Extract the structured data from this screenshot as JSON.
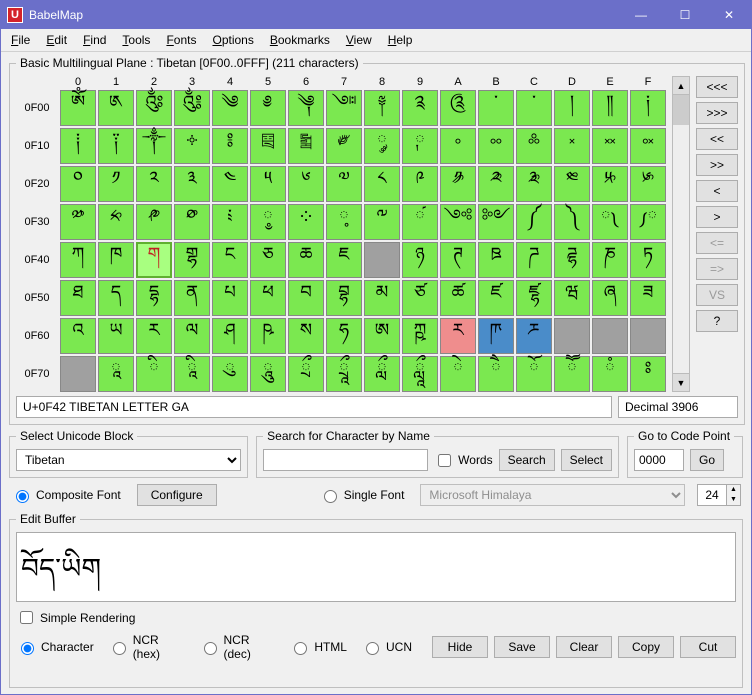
{
  "window": {
    "title": "BabelMap",
    "icon_letter": "U"
  },
  "menubar": [
    "File",
    "Edit",
    "Find",
    "Tools",
    "Fonts",
    "Options",
    "Bookmarks",
    "View",
    "Help"
  ],
  "grid": {
    "legend": "Basic Multilingual Plane : Tibetan [0F00..0FFF] (211 characters)",
    "col_headers": [
      "0",
      "1",
      "2",
      "3",
      "4",
      "5",
      "6",
      "7",
      "8",
      "9",
      "A",
      "B",
      "C",
      "D",
      "E",
      "F"
    ],
    "rows": [
      {
        "hdr": "0F00",
        "cells": [
          {
            "g": "ༀ",
            "c": "g"
          },
          {
            "g": "༁",
            "c": "g"
          },
          {
            "g": "༂",
            "c": "g"
          },
          {
            "g": "༃",
            "c": "g"
          },
          {
            "g": "༄",
            "c": "g"
          },
          {
            "g": "༅",
            "c": "g"
          },
          {
            "g": "༆",
            "c": "g"
          },
          {
            "g": "༇",
            "c": "g"
          },
          {
            "g": "༈",
            "c": "g"
          },
          {
            "g": "༉",
            "c": "g"
          },
          {
            "g": "༊",
            "c": "g"
          },
          {
            "g": "་",
            "c": "g"
          },
          {
            "g": "༌",
            "c": "g"
          },
          {
            "g": "།",
            "c": "g"
          },
          {
            "g": "༎",
            "c": "g"
          },
          {
            "g": "༏",
            "c": "g"
          }
        ]
      },
      {
        "hdr": "0F10",
        "cells": [
          {
            "g": "༐",
            "c": "g"
          },
          {
            "g": "༑",
            "c": "g"
          },
          {
            "g": "༒",
            "c": "g"
          },
          {
            "g": "༓",
            "c": "g"
          },
          {
            "g": "༔",
            "c": "g"
          },
          {
            "g": "༕",
            "c": "g"
          },
          {
            "g": "༖",
            "c": "g"
          },
          {
            "g": "༗",
            "c": "g"
          },
          {
            "g": "༘",
            "c": "g"
          },
          {
            "g": "༙",
            "c": "g"
          },
          {
            "g": "༚",
            "c": "g"
          },
          {
            "g": "༛",
            "c": "g"
          },
          {
            "g": "༜",
            "c": "g"
          },
          {
            "g": "༝",
            "c": "g"
          },
          {
            "g": "༞",
            "c": "g"
          },
          {
            "g": "༟",
            "c": "g"
          }
        ]
      },
      {
        "hdr": "0F20",
        "cells": [
          {
            "g": "༠",
            "c": "g"
          },
          {
            "g": "༡",
            "c": "g"
          },
          {
            "g": "༢",
            "c": "g"
          },
          {
            "g": "༣",
            "c": "g"
          },
          {
            "g": "༤",
            "c": "g"
          },
          {
            "g": "༥",
            "c": "g"
          },
          {
            "g": "༦",
            "c": "g"
          },
          {
            "g": "༧",
            "c": "g"
          },
          {
            "g": "༨",
            "c": "g"
          },
          {
            "g": "༩",
            "c": "g"
          },
          {
            "g": "༪",
            "c": "g"
          },
          {
            "g": "༫",
            "c": "g"
          },
          {
            "g": "༬",
            "c": "g"
          },
          {
            "g": "༭",
            "c": "g"
          },
          {
            "g": "༮",
            "c": "g"
          },
          {
            "g": "༯",
            "c": "g"
          }
        ]
      },
      {
        "hdr": "0F30",
        "cells": [
          {
            "g": "༰",
            "c": "g"
          },
          {
            "g": "༱",
            "c": "g"
          },
          {
            "g": "༲",
            "c": "g"
          },
          {
            "g": "༳",
            "c": "g"
          },
          {
            "g": "༴",
            "c": "g"
          },
          {
            "g": "༵",
            "c": "g"
          },
          {
            "g": "༶",
            "c": "g"
          },
          {
            "g": "༷",
            "c": "g"
          },
          {
            "g": "༸",
            "c": "g"
          },
          {
            "g": "༹",
            "c": "g"
          },
          {
            "g": "༺",
            "c": "g"
          },
          {
            "g": "༻",
            "c": "g"
          },
          {
            "g": "༼",
            "c": "g"
          },
          {
            "g": "༽",
            "c": "g"
          },
          {
            "g": "༾",
            "c": "g"
          },
          {
            "g": "༿",
            "c": "g"
          }
        ]
      },
      {
        "hdr": "0F40",
        "cells": [
          {
            "g": "ཀ",
            "c": "g"
          },
          {
            "g": "ཁ",
            "c": "g"
          },
          {
            "g": "ག",
            "c": "sel"
          },
          {
            "g": "གྷ",
            "c": "g"
          },
          {
            "g": "ང",
            "c": "g"
          },
          {
            "g": "ཅ",
            "c": "g"
          },
          {
            "g": "ཆ",
            "c": "g"
          },
          {
            "g": "ཇ",
            "c": "g"
          },
          {
            "g": "",
            "c": "gray"
          },
          {
            "g": "ཉ",
            "c": "g"
          },
          {
            "g": "ཊ",
            "c": "g"
          },
          {
            "g": "ཋ",
            "c": "g"
          },
          {
            "g": "ཌ",
            "c": "g"
          },
          {
            "g": "ཌྷ",
            "c": "g"
          },
          {
            "g": "ཎ",
            "c": "g"
          },
          {
            "g": "ཏ",
            "c": "g"
          }
        ]
      },
      {
        "hdr": "0F50",
        "cells": [
          {
            "g": "ཐ",
            "c": "g"
          },
          {
            "g": "ད",
            "c": "g"
          },
          {
            "g": "དྷ",
            "c": "g"
          },
          {
            "g": "ན",
            "c": "g"
          },
          {
            "g": "པ",
            "c": "g"
          },
          {
            "g": "ཕ",
            "c": "g"
          },
          {
            "g": "བ",
            "c": "g"
          },
          {
            "g": "བྷ",
            "c": "g"
          },
          {
            "g": "མ",
            "c": "g"
          },
          {
            "g": "ཙ",
            "c": "g"
          },
          {
            "g": "ཚ",
            "c": "g"
          },
          {
            "g": "ཛ",
            "c": "g"
          },
          {
            "g": "ཛྷ",
            "c": "g"
          },
          {
            "g": "ཝ",
            "c": "g"
          },
          {
            "g": "ཞ",
            "c": "g"
          },
          {
            "g": "ཟ",
            "c": "g"
          }
        ]
      },
      {
        "hdr": "0F60",
        "cells": [
          {
            "g": "འ",
            "c": "g"
          },
          {
            "g": "ཡ",
            "c": "g"
          },
          {
            "g": "ར",
            "c": "g"
          },
          {
            "g": "ལ",
            "c": "g"
          },
          {
            "g": "ཤ",
            "c": "g"
          },
          {
            "g": "ཥ",
            "c": "g"
          },
          {
            "g": "ས",
            "c": "g"
          },
          {
            "g": "ཧ",
            "c": "g"
          },
          {
            "g": "ཨ",
            "c": "g"
          },
          {
            "g": "ཀྵ",
            "c": "g"
          },
          {
            "g": "ཪ",
            "c": "red"
          },
          {
            "g": "ཫ",
            "c": "blue"
          },
          {
            "g": "ཬ",
            "c": "blue"
          },
          {
            "g": "",
            "c": "gray"
          },
          {
            "g": "",
            "c": "gray"
          },
          {
            "g": "",
            "c": "gray"
          }
        ]
      },
      {
        "hdr": "0F70",
        "cells": [
          {
            "g": "",
            "c": "gray"
          },
          {
            "g": "ཱ",
            "c": "g"
          },
          {
            "g": "ི",
            "c": "g"
          },
          {
            "g": "ཱི",
            "c": "g"
          },
          {
            "g": "ུ",
            "c": "g"
          },
          {
            "g": "ཱུ",
            "c": "g"
          },
          {
            "g": "ྲྀ",
            "c": "g"
          },
          {
            "g": "ཷ",
            "c": "g"
          },
          {
            "g": "ླྀ",
            "c": "g"
          },
          {
            "g": "ཹ",
            "c": "g"
          },
          {
            "g": "ེ",
            "c": "g"
          },
          {
            "g": "ཻ",
            "c": "g"
          },
          {
            "g": "ོ",
            "c": "g"
          },
          {
            "g": "ཽ",
            "c": "g"
          },
          {
            "g": "ཾ",
            "c": "g"
          },
          {
            "g": "ཿ",
            "c": "g"
          }
        ]
      }
    ]
  },
  "nav_buttons": [
    "<<<",
    ">>>",
    "<<",
    ">>",
    "<",
    ">",
    "<=",
    "=>",
    "VS",
    "?"
  ],
  "status": {
    "name": "U+0F42 TIBETAN LETTER GA",
    "decimal": "Decimal 3906"
  },
  "select_block": {
    "legend": "Select Unicode Block",
    "value": "Tibetan",
    "composite_label": "Composite Font",
    "configure": "Configure",
    "single_label": "Single Font",
    "single_font_value": "Microsoft Himalaya",
    "font_size": "24"
  },
  "search": {
    "legend": "Search for Character by Name",
    "value": "",
    "words_label": "Words",
    "search_btn": "Search",
    "select_btn": "Select"
  },
  "goto": {
    "legend": "Go to Code Point",
    "value": "0000",
    "go": "Go"
  },
  "edit": {
    "legend": "Edit Buffer",
    "text": "བོད་ཡིག",
    "simple_label": "Simple Rendering",
    "radios": [
      "Character",
      "NCR (hex)",
      "NCR (dec)",
      "HTML",
      "UCN"
    ],
    "buttons": [
      "Hide",
      "Save",
      "Clear",
      "Copy",
      "Cut"
    ]
  }
}
